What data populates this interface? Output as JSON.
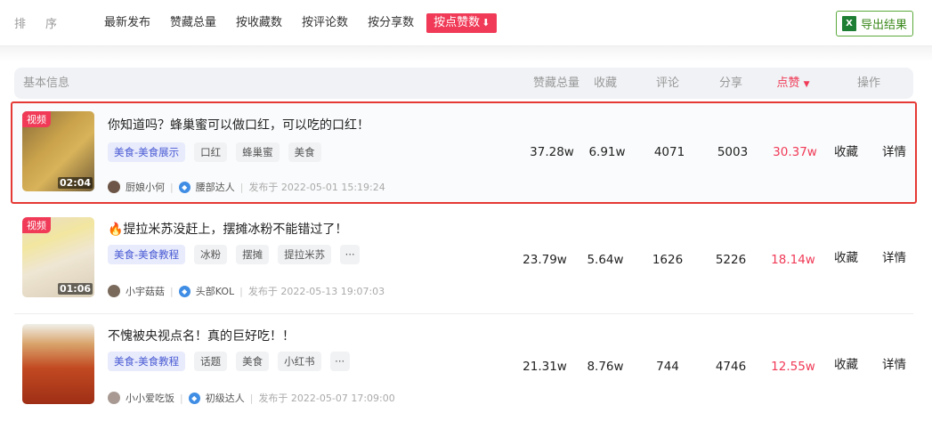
{
  "sortbar": {
    "label": "排序",
    "options": [
      "最新发布",
      "赞藏总量",
      "按收藏数",
      "按评论数",
      "按分享数"
    ],
    "active_label": "按点赞数",
    "active_arrow": "⬇",
    "export_label": "导出结果",
    "export_icon_letter": "X"
  },
  "table_header": {
    "basic": "基本信息",
    "total": "赞藏总量",
    "fav": "收藏",
    "comment": "评论",
    "share": "分享",
    "like": "点赞",
    "like_caret": "▼",
    "ops": "操作"
  },
  "rows": [
    {
      "badge": "视频",
      "duration": "02:04",
      "title": "你知道吗？蜂巢蜜可以做口红，可以吃的口红！",
      "tags": [
        "美食-美食展示",
        "口红",
        "蜂巢蜜",
        "美食"
      ],
      "author": "厨娘小何",
      "level": "腰部达人",
      "published": "发布于  2022-05-01 15:19:24",
      "total": "37.28w",
      "fav": "6.91w",
      "comment": "4071",
      "share": "5003",
      "like": "30.37w",
      "op_fav": "收藏",
      "op_detail": "详情"
    },
    {
      "badge": "视频",
      "duration": "01:06",
      "title": "🔥提拉米苏没赶上，摆摊冰粉不能错过了！",
      "tags": [
        "美食-美食教程",
        "冰粉",
        "摆摊",
        "提拉米苏",
        "···"
      ],
      "author": "小宇菇菇",
      "level": "头部KOL",
      "published": "发布于  2022-05-13 19:07:03",
      "total": "23.79w",
      "fav": "5.64w",
      "comment": "1626",
      "share": "5226",
      "like": "18.14w",
      "op_fav": "收藏",
      "op_detail": "详情"
    },
    {
      "badge": "",
      "duration": "",
      "title": "不愧被央视点名！真的巨好吃！！",
      "tags": [
        "美食-美食教程",
        "话题",
        "美食",
        "小红书",
        "···"
      ],
      "author": "小小爱吃饭",
      "level": "初级达人",
      "published": "发布于  2022-05-07 17:09:00",
      "total": "21.31w",
      "fav": "8.76w",
      "comment": "744",
      "share": "4746",
      "like": "12.55w",
      "op_fav": "收藏",
      "op_detail": "详情"
    }
  ],
  "colors": {
    "accent_red": "#f03a57",
    "highlight_border": "#e53935",
    "export_green": "#3c8a1e",
    "tag_primary": "#4a5bd4"
  }
}
